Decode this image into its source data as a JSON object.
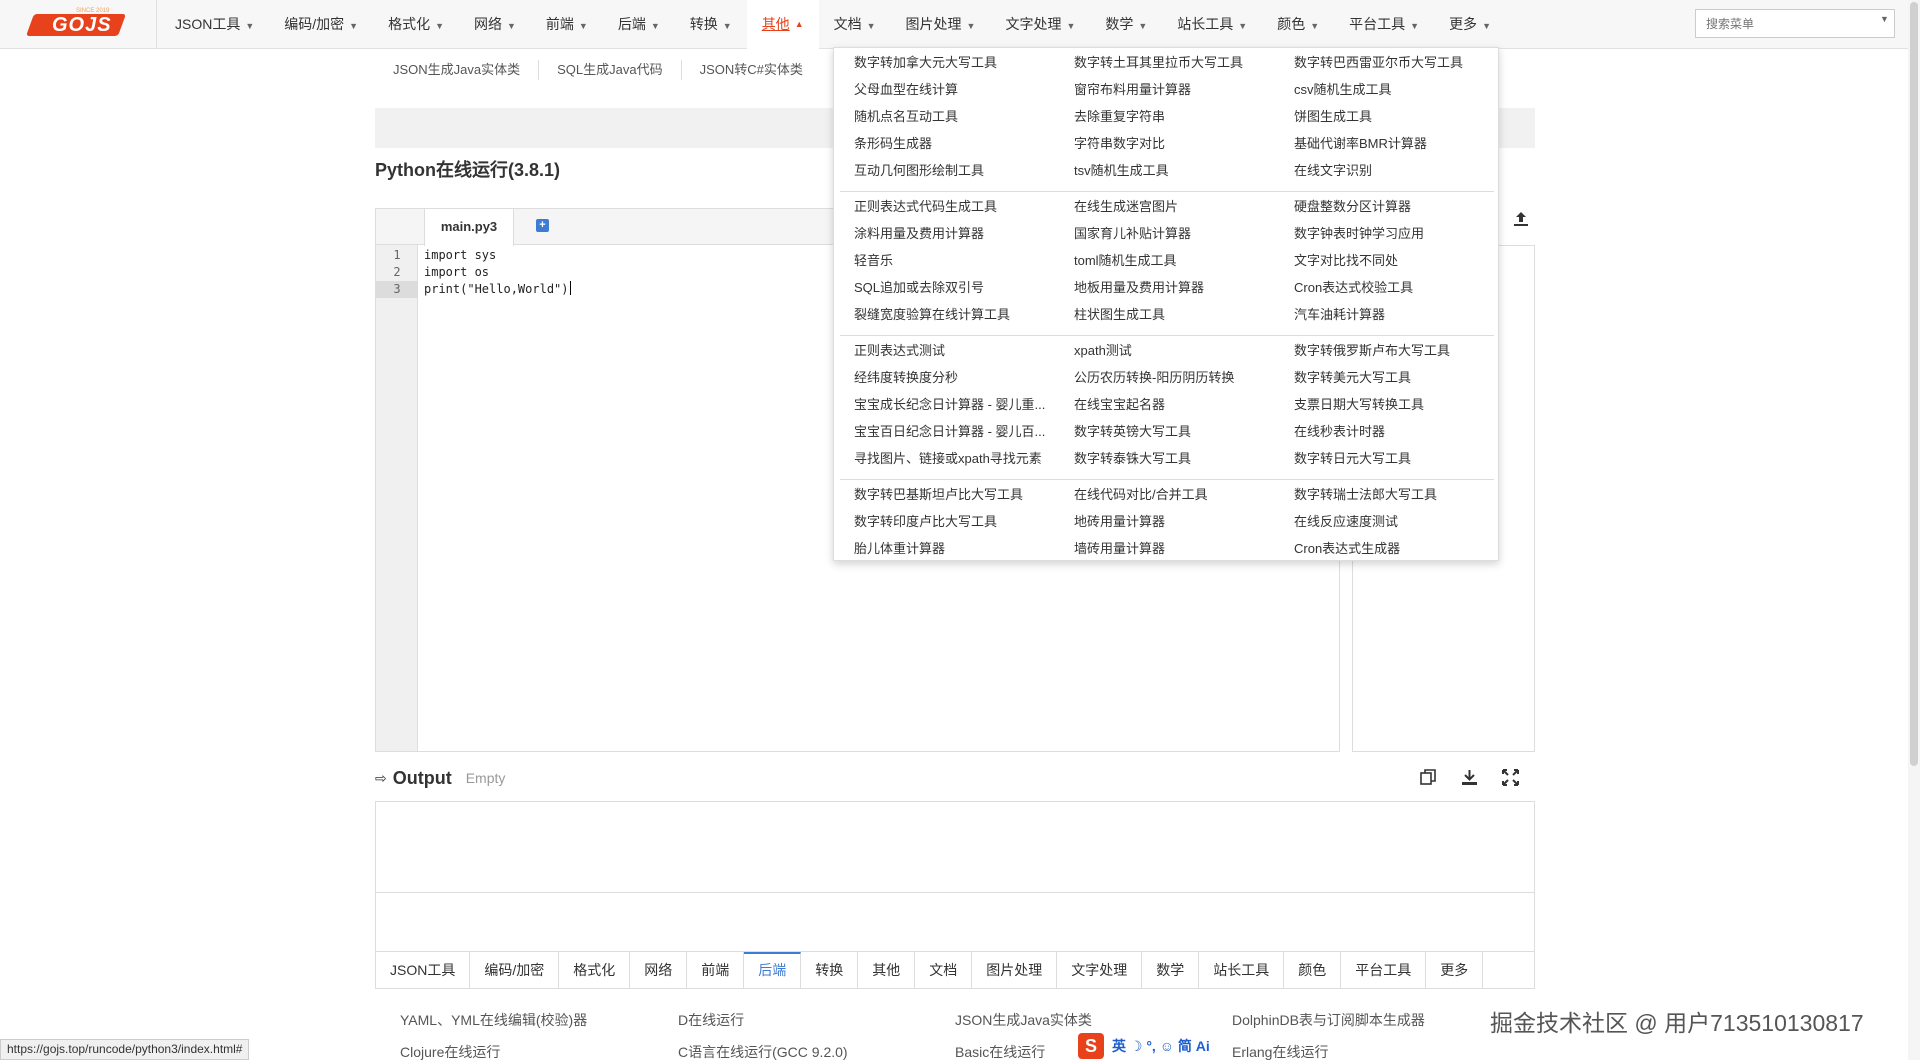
{
  "nav": {
    "logo": "GOJS",
    "logo_small": "SINCE 2019",
    "items": [
      {
        "label": "JSON工具",
        "active": false
      },
      {
        "label": "编码/加密",
        "active": false
      },
      {
        "label": "格式化",
        "active": false
      },
      {
        "label": "网络",
        "active": false
      },
      {
        "label": "前端",
        "active": false
      },
      {
        "label": "后端",
        "active": false
      },
      {
        "label": "转换",
        "active": false
      },
      {
        "label": "其他",
        "active": true
      },
      {
        "label": "文档",
        "active": false
      },
      {
        "label": "图片处理",
        "active": false
      },
      {
        "label": "文字处理",
        "active": false
      },
      {
        "label": "数学",
        "active": false
      },
      {
        "label": "站长工具",
        "active": false
      },
      {
        "label": "颜色",
        "active": false
      },
      {
        "label": "平台工具",
        "active": false
      },
      {
        "label": "更多",
        "active": false
      }
    ],
    "search_placeholder": "搜索菜单"
  },
  "sublinks": [
    "JSON生成Java实体类",
    "SQL生成Java代码",
    "JSON转C#实体类"
  ],
  "page_title": "Python在线运行(3.8.1)",
  "editor": {
    "tab_label": "main.py3",
    "add_label": "+",
    "lines": [
      {
        "num": "1",
        "text": "import sys",
        "current": false
      },
      {
        "num": "2",
        "text": "import os",
        "current": false
      },
      {
        "num": "3",
        "text": "print(\"Hello,World\")",
        "current": true
      }
    ]
  },
  "output": {
    "title": "Output",
    "status": "Empty"
  },
  "bottom_tabs": {
    "active": "后端",
    "items": [
      "JSON工具",
      "编码/加密",
      "格式化",
      "网络",
      "前端",
      "后端",
      "转换",
      "其他",
      "文档",
      "图片处理",
      "文字处理",
      "数学",
      "站长工具",
      "颜色",
      "平台工具",
      "更多"
    ]
  },
  "bottom_links": [
    [
      "YAML、YML在线编辑(校验)器",
      "D在线运行",
      "JSON生成Java实体类",
      "DolphinDB表与订阅脚本生成器"
    ],
    [
      "Clojure在线运行",
      "C语言在线运行(GCC 9.2.0)",
      "Basic在线运行",
      "Erlang在线运行"
    ]
  ],
  "dropdown": {
    "groups": [
      [
        [
          "数字转加拿大元大写工具",
          "数字转土耳其里拉币大写工具",
          "数字转巴西雷亚尔币大写工具"
        ],
        [
          "父母血型在线计算",
          "窗帘布料用量计算器",
          "csv随机生成工具"
        ],
        [
          "随机点名互动工具",
          "去除重复字符串",
          "饼图生成工具"
        ],
        [
          "条形码生成器",
          "字符串数字对比",
          "基础代谢率BMR计算器"
        ],
        [
          "互动几何图形绘制工具",
          "tsv随机生成工具",
          "在线文字识别"
        ]
      ],
      [
        [
          "正则表达式代码生成工具",
          "在线生成迷宫图片",
          "硬盘整数分区计算器"
        ],
        [
          "涂料用量及费用计算器",
          "国家育儿补贴计算器",
          "数字钟表时钟学习应用"
        ],
        [
          "轻音乐",
          "toml随机生成工具",
          "文字对比找不同处"
        ],
        [
          "SQL追加或去除双引号",
          "地板用量及费用计算器",
          "Cron表达式校验工具"
        ],
        [
          "裂缝宽度验算在线计算工具",
          "柱状图生成工具",
          "汽车油耗计算器"
        ]
      ],
      [
        [
          "正则表达式测试",
          "xpath测试",
          "数字转俄罗斯卢布大写工具"
        ],
        [
          "经纬度转换度分秒",
          "公历农历转换-阳历阴历转换",
          "数字转美元大写工具"
        ],
        [
          "宝宝成长纪念日计算器 - 婴儿重...",
          "在线宝宝起名器",
          "支票日期大写转换工具"
        ],
        [
          "宝宝百日纪念日计算器 - 婴儿百...",
          "数字转英镑大写工具",
          "在线秒表计时器"
        ],
        [
          "寻找图片、链接或xpath寻找元素",
          "数字转泰铢大写工具",
          "数字转日元大写工具"
        ]
      ],
      [
        [
          "数字转巴基斯坦卢比大写工具",
          "在线代码对比/合并工具",
          "数字转瑞士法郎大写工具"
        ],
        [
          "数字转印度卢比大写工具",
          "地砖用量计算器",
          "在线反应速度测试"
        ],
        [
          "胎儿体重计算器",
          "墙砖用量计算器",
          "Cron表达式生成器"
        ]
      ]
    ]
  },
  "status_url": "https://gojs.top/runcode/python3/index.html#",
  "watermark": "掘金技术社区 @ 用户713510130817",
  "ime": {
    "logo": "S",
    "text": "英 ☽ °, ☺ 简 Ai"
  },
  "colors": {
    "brand": "#e8421c",
    "accent": "#3e7bd2"
  }
}
